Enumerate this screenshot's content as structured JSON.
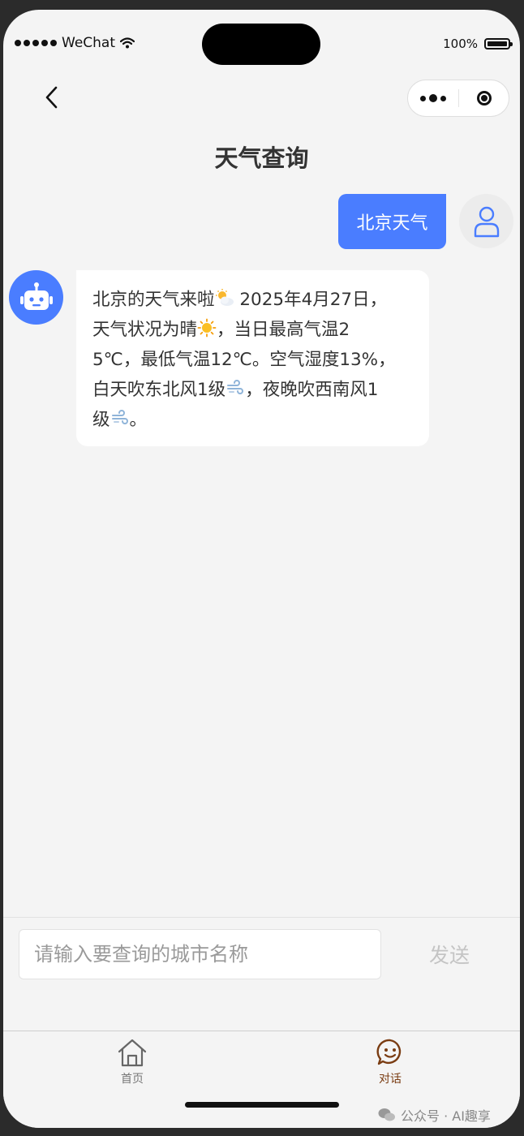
{
  "status_bar": {
    "carrier": "WeChat",
    "battery": "100%"
  },
  "nav": {
    "title": "天气查询"
  },
  "messages": {
    "user_text": "北京天气",
    "bot_lines": [
      {
        "pre": "北京的天气来啦",
        "emoji": "partly-sunny-icon",
        "post": " 2025年4月27日，"
      },
      {
        "pre": "天气状况为晴",
        "emoji": "sun-icon",
        "post": "，当日最高气温2"
      },
      {
        "pre": "5℃，最低气温12℃。空气湿度13%，",
        "emoji": "",
        "post": ""
      },
      {
        "pre": "白天吹东北风1级",
        "emoji": "wind-icon",
        "post": "，夜晚吹西南风1"
      },
      {
        "pre": "级",
        "emoji": "wind-icon",
        "post": "。"
      }
    ]
  },
  "input": {
    "placeholder": "请输入要查询的城市名称",
    "value": "",
    "send_label": "发送"
  },
  "tabbar": {
    "home_label": "首页",
    "chat_label": "对话",
    "active": "对话"
  },
  "colors": {
    "accent": "#4a7dff",
    "active_tab": "#7a3c12",
    "background": "#f4f4f4"
  },
  "watermark": "公众号 · AI趣享"
}
